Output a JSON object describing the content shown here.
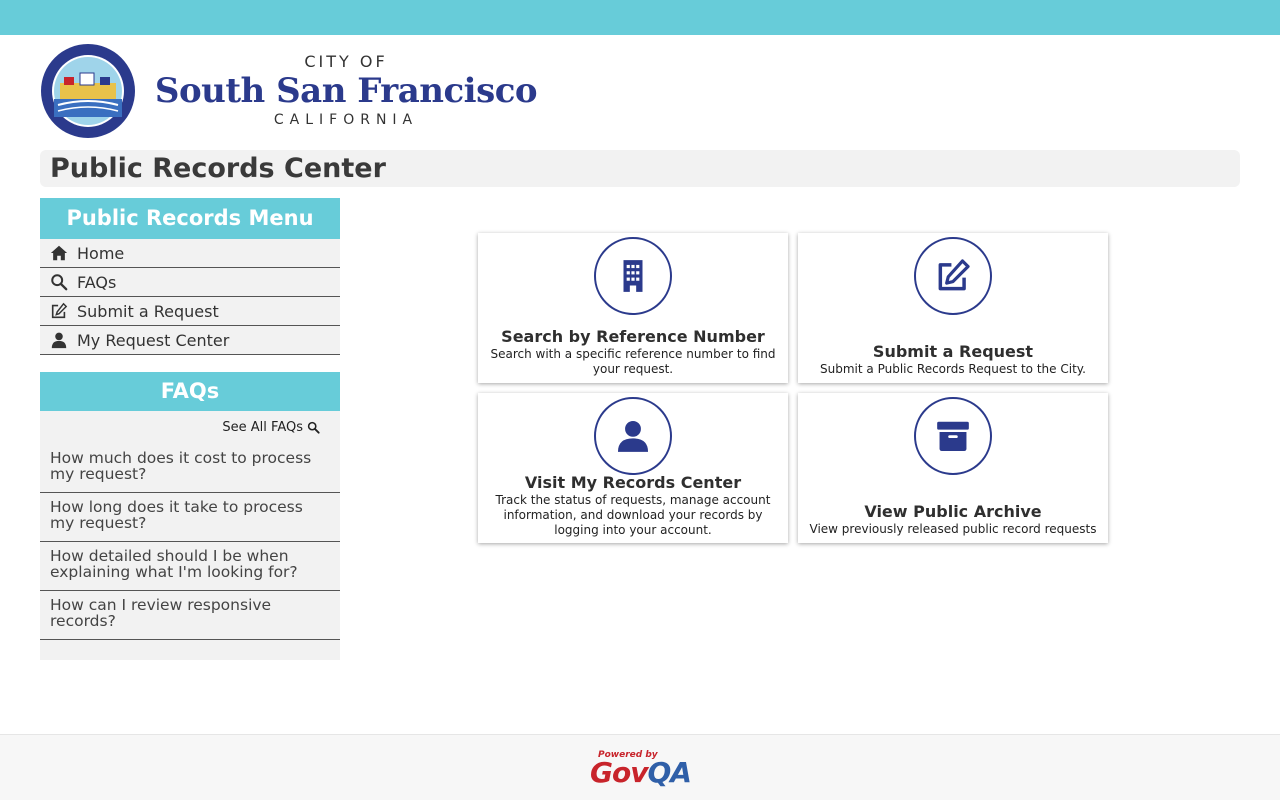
{
  "header": {
    "logo": {
      "city_of": "CITY OF",
      "name": "South San Francisco",
      "state": "CALIFORNIA",
      "seal_text": "CITY OF SOUTH SAN FRANCISCO CALIFORNIA"
    }
  },
  "page": {
    "title": "Public Records Center"
  },
  "sidebar": {
    "menu_title": "Public Records Menu",
    "items": [
      {
        "label": "Home",
        "icon": "home-icon"
      },
      {
        "label": "FAQs",
        "icon": "search-icon"
      },
      {
        "label": "Submit a Request",
        "icon": "edit-icon"
      },
      {
        "label": "My Request Center",
        "icon": "user-icon"
      }
    ],
    "faq_title": "FAQs",
    "see_all": "See All FAQs",
    "faqs": [
      "How much does it cost to process my request?",
      "How long does it take to process my request?",
      "How detailed should I be when explaining what I'm looking for?",
      "How can I review responsive records?"
    ]
  },
  "cards": [
    {
      "title": "Search by Reference Number",
      "description": "Search with a specific reference number to find your request.",
      "icon": "building-icon"
    },
    {
      "title": "Submit a Request",
      "description": "Submit a Public Records Request to the City.",
      "icon": "edit-icon"
    },
    {
      "title": "Visit My Records Center",
      "description": "Track the status of requests, manage account information, and download your records by logging into your account.",
      "icon": "user-icon"
    },
    {
      "title": "View Public Archive",
      "description": "View previously released public record requests",
      "icon": "archive-icon"
    }
  ],
  "footer": {
    "powered_by": "Powered by",
    "brand_gov": "Gov",
    "brand_qa": "QA"
  },
  "colors": {
    "accent": "#67ccd9",
    "brand_navy": "#2b3a8c",
    "panel_bg": "#f2f2f2",
    "govqa_red": "#c8242b",
    "govqa_blue": "#2f5fa8"
  }
}
